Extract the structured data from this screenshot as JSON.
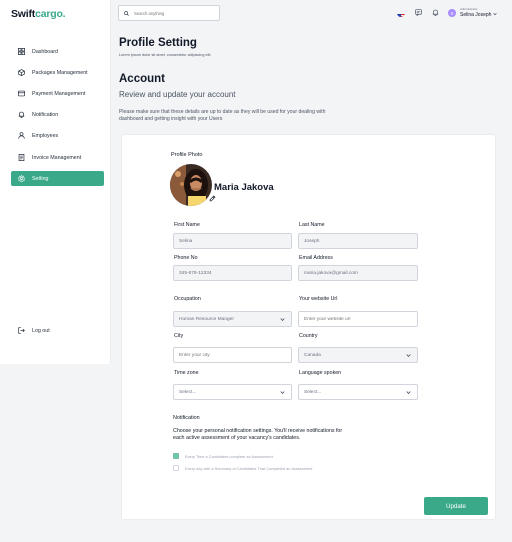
{
  "brand": {
    "part1": "Swift",
    "part2": "cargo."
  },
  "colors": {
    "accent": "#3aa98a",
    "avatar": "#a78bfa"
  },
  "sidebar": {
    "items": [
      {
        "label": "Dashboard",
        "icon": "dashboard-icon"
      },
      {
        "label": "Packages Management",
        "icon": "package-icon"
      },
      {
        "label": "Payment Management",
        "icon": "card-icon"
      },
      {
        "label": "Notification",
        "icon": "bell-icon"
      },
      {
        "label": "Employees",
        "icon": "user-icon"
      },
      {
        "label": "Invoice Management",
        "icon": "invoice-icon"
      },
      {
        "label": "Setting",
        "icon": "gear-icon",
        "active": true
      }
    ],
    "logout": "Log out"
  },
  "topbar": {
    "search_placeholder": "Search anything",
    "user_role": "Administrator",
    "user_name": "Selina Joseph",
    "user_initial": "S"
  },
  "header": {
    "title": "Profile Setting",
    "subtitle": "Lorem ipsum dolor sit amet, consectetur adipiscing elit."
  },
  "account": {
    "title": "Account",
    "subtitle": "Review and update your account",
    "description": "Please make sure that these details are up to date as they will be used for your dealing with dashboard and getting insight with your Users"
  },
  "profile": {
    "photo_label": "Profile Photo",
    "name": "Maria Jakova"
  },
  "form": {
    "first_name": {
      "label": "First Name",
      "value": "Selina"
    },
    "last_name": {
      "label": "Last Name",
      "value": "Joseph"
    },
    "phone": {
      "label": "Phone No",
      "value": "345-678-12334"
    },
    "email": {
      "label": "Email Address",
      "value": "maria.jakova@gmail.com"
    },
    "occupation": {
      "label": "Occupation",
      "value": "Human Resource Manger"
    },
    "website": {
      "label": "Your website Url",
      "placeholder": "Enter your website url"
    },
    "city": {
      "label": "City",
      "placeholder": "Enter your city"
    },
    "country": {
      "label": "Country",
      "value": "Canada"
    },
    "timezone": {
      "label": "Time zone",
      "value": "Select..."
    },
    "language": {
      "label": "Language spoken",
      "value": "Select..."
    }
  },
  "notification": {
    "title": "Notification",
    "description": "Choose your personal notification settings. You'll receive notifications for each active assessment of your vacancy's candidates.",
    "options": [
      {
        "label": "Every Time a Candidates complete an Assessment",
        "checked": true
      },
      {
        "label": "Every day with a Summary of Candidates That Completed an Assessment",
        "checked": false
      }
    ]
  },
  "update_label": "Update"
}
